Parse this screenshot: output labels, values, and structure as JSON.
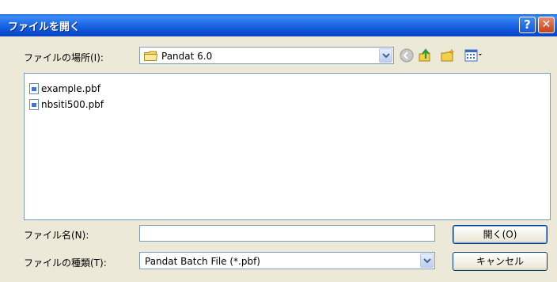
{
  "window": {
    "title": "ファイルを開く",
    "help_glyph": "?",
    "close_glyph": "✕"
  },
  "location": {
    "label": "ファイルの場所(I):",
    "value": "Pandat 6.0"
  },
  "toolbar": {
    "icons": [
      "back-icon",
      "up-folder-icon",
      "new-folder-icon",
      "view-menu-icon"
    ]
  },
  "files": [
    {
      "name": "example.pbf"
    },
    {
      "name": "nbsiti500.pbf"
    }
  ],
  "filename": {
    "label": "ファイル名(N):",
    "value": ""
  },
  "filetype": {
    "label": "ファイルの種類(T):",
    "value": "Pandat Batch File (*.pbf)"
  },
  "buttons": {
    "open": "開く(O)",
    "cancel": "キャンセル"
  },
  "colors": {
    "titlebar": "#0a5fdc",
    "dialog_bg": "#ece9d8",
    "field_border": "#7f9db9"
  }
}
